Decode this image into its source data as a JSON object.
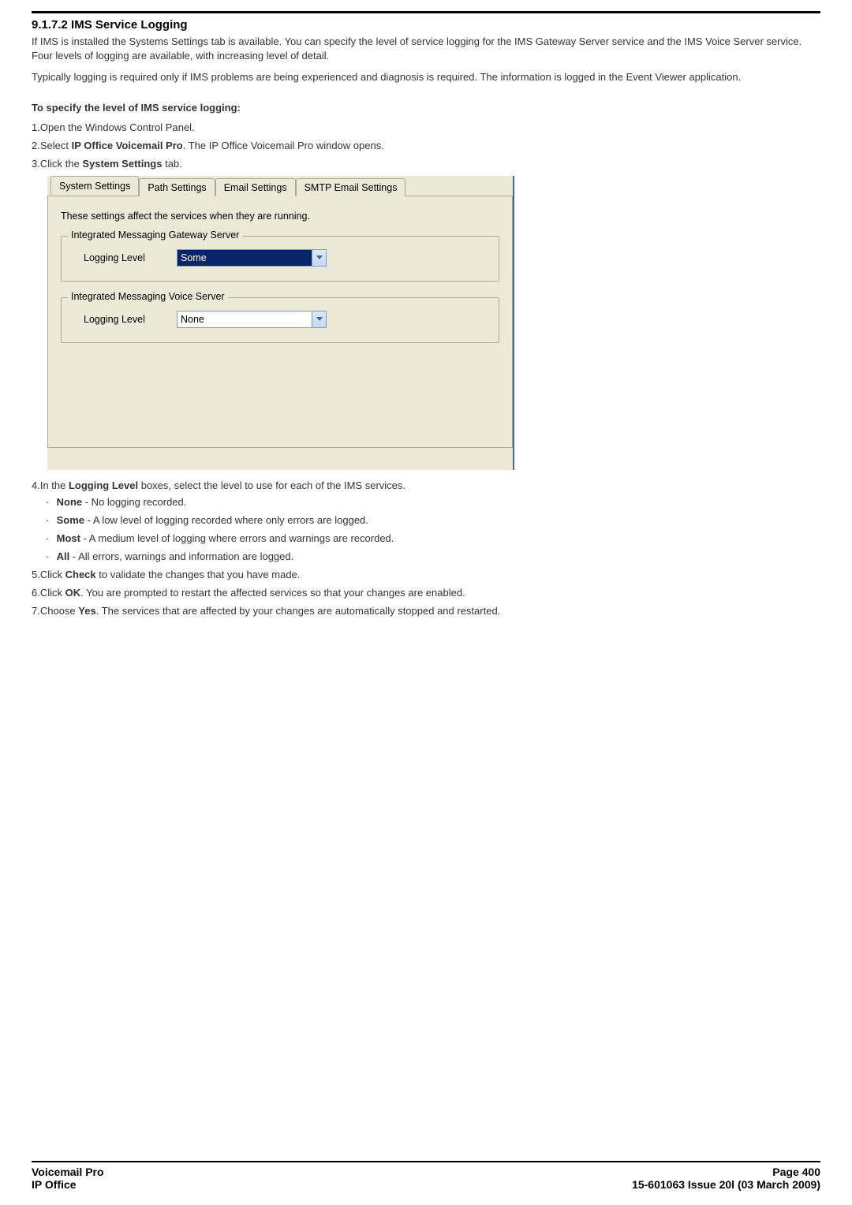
{
  "heading": "9.1.7.2 IMS Service Logging",
  "para1": "If IMS is installed the Systems Settings tab is available. You can specify the level of service logging for the IMS Gateway Server service and the IMS Voice Server service. Four levels of logging are available, with increasing level of detail.",
  "para2": "Typically logging is required only if IMS problems are being experienced and diagnosis is required. The information is logged in the Event Viewer application.",
  "subhead": "To specify the level of IMS service logging:",
  "steps": {
    "s1": "Open the Windows Control Panel.",
    "s2_a": "Select ",
    "s2_b": "IP Office Voicemail Pro",
    "s2_c": ". The IP Office Voicemail Pro window opens.",
    "s3_a": "Click the ",
    "s3_b": "System Settings",
    "s3_c": " tab.",
    "s4_a": "In the ",
    "s4_b": "Logging Level",
    "s4_c": " boxes, select the level to use for each of the IMS services.",
    "s5_a": "Click ",
    "s5_b": "Check",
    "s5_c": " to validate the changes that you have made.",
    "s6_a": "Click ",
    "s6_b": "OK",
    "s6_c": ". You are prompted to restart the affected services so that your changes are enabled.",
    "s7_a": "Choose ",
    "s7_b": "Yes",
    "s7_c": ". The services that are affected by your changes are automatically stopped and restarted."
  },
  "bullets": {
    "b1_a": "None",
    "b1_b": " - No logging recorded.",
    "b2_a": "Some",
    "b2_b": " - A low level of logging recorded where only errors are logged.",
    "b3_a": "Most",
    "b3_b": " - A medium level of logging where errors and warnings are recorded.",
    "b4_a": "All",
    "b4_b": " - All errors, warnings and information are logged."
  },
  "dialog": {
    "tabs": {
      "t1": "System Settings",
      "t2": "Path Settings",
      "t3": "Email Settings",
      "t4": "SMTP Email Settings"
    },
    "desc": "These settings affect the services when they are running.",
    "fs1_legend": "Integrated Messaging Gateway Server",
    "fs2_legend": "Integrated Messaging Voice Server",
    "label": "Logging Level",
    "combo1": "Some",
    "combo2": "None"
  },
  "footer": {
    "left1": "Voicemail Pro",
    "left2": "IP Office",
    "right1": "Page 400",
    "right2": "15-601063 Issue 20l (03 March 2009)"
  }
}
